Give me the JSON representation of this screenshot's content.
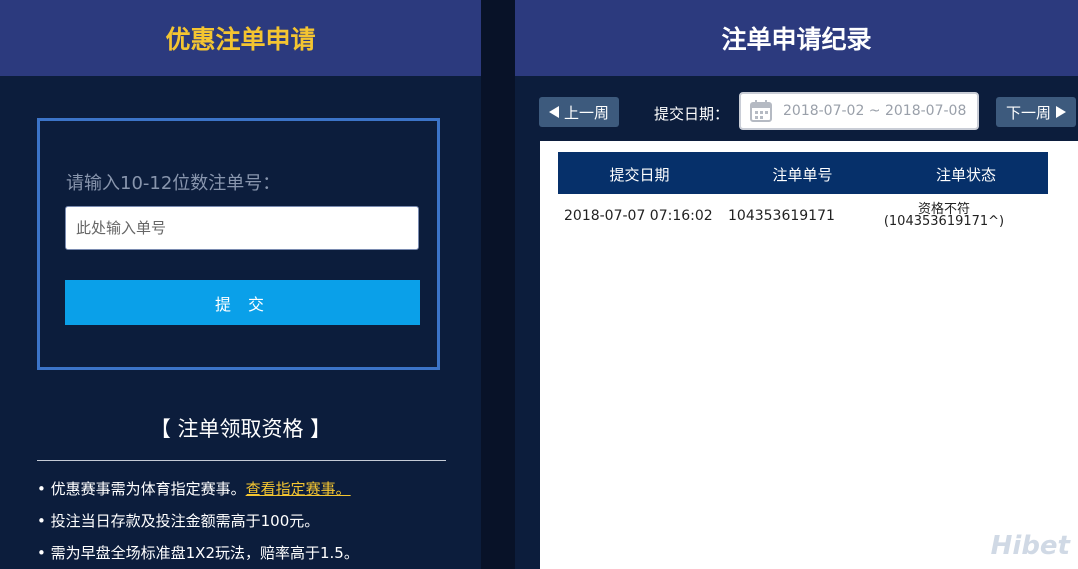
{
  "left": {
    "title": "优惠注单申请",
    "form_label": "请输入10-12位数注单号：",
    "input_placeholder": "此处输入单号",
    "submit_label": "提 交",
    "eligibility_title": "【 注单领取资格 】",
    "rules": [
      {
        "prefix": "• ",
        "text": "优惠赛事需为体育指定赛事。",
        "link": "查看指定赛事。"
      },
      {
        "prefix": "• ",
        "text": "投注当日存款及投注金额需高于100元。"
      },
      {
        "prefix": "• ",
        "text": "需为早盘全场标准盘1X2玩法，赔率高于1.5。"
      }
    ]
  },
  "right": {
    "title": "注单申请纪录",
    "prev_week": "上一周",
    "next_week": "下一周",
    "date_label": "提交日期：",
    "date_range": "2018-07-02 ~ 2018-07-08",
    "columns": [
      "提交日期",
      "注单单号",
      "注单状态"
    ],
    "rows": [
      {
        "date": "2018-07-07 07:16:02",
        "order_no": "104353619171",
        "status_line1": "资格不符",
        "status_line2": "(104353619171^)"
      }
    ]
  },
  "watermark": "Hibet",
  "colors": {
    "header_bg": "#2c3a7e",
    "panel_bg": "#0c1d3c",
    "accent_gold": "#f4c531",
    "submit_blue": "#0aa0e9",
    "table_head_bg": "#06306a",
    "box_border": "#3c74c8"
  },
  "icons": [
    "calendar-icon",
    "arrow-left-icon",
    "arrow-right-icon"
  ]
}
